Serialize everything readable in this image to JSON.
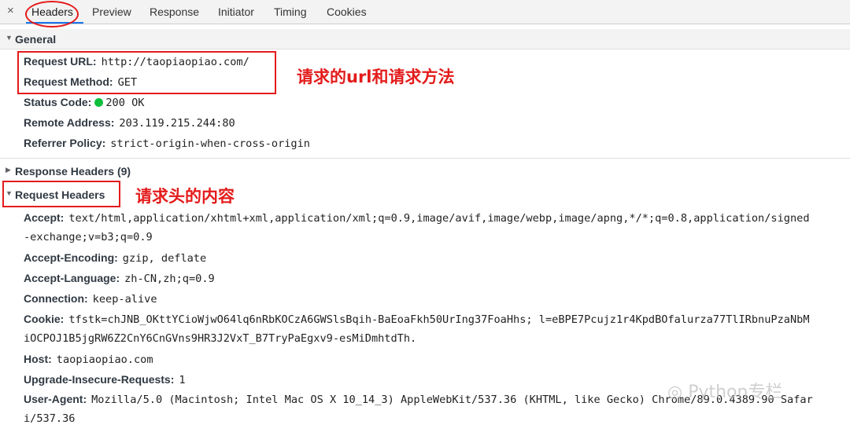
{
  "tabs": {
    "close_icon": "×",
    "items": [
      "Headers",
      "Preview",
      "Response",
      "Initiator",
      "Timing",
      "Cookies"
    ],
    "active": "Headers"
  },
  "general": {
    "title": "General",
    "rows": [
      {
        "key": "Request URL:",
        "value": "http://taopiaopiao.com/"
      },
      {
        "key": "Request Method:",
        "value": "GET"
      },
      {
        "key": "Status Code:",
        "value": "200 OK",
        "status_color": "#0dbf3c"
      },
      {
        "key": "Remote Address:",
        "value": "203.119.215.244:80"
      },
      {
        "key": "Referrer Policy:",
        "value": "strict-origin-when-cross-origin"
      }
    ]
  },
  "response_headers": {
    "title": "Response Headers (9)"
  },
  "request_headers": {
    "title": "Request Headers",
    "rows": [
      {
        "key": "Accept:",
        "value": "text/html,application/xhtml+xml,application/xml;q=0.9,image/avif,image/webp,image/apng,*/*;q=0.8,application/signed",
        "cont": "-exchange;v=b3;q=0.9"
      },
      {
        "key": "Accept-Encoding:",
        "value": "gzip, deflate"
      },
      {
        "key": "Accept-Language:",
        "value": "zh-CN,zh;q=0.9"
      },
      {
        "key": "Connection:",
        "value": "keep-alive"
      },
      {
        "key": "Cookie:",
        "value": "tfstk=chJNB_OKttYCioWjwO64lq6nRbKOCzA6GWSlsBqih-BaEoaFkh50UrIng37FoaHhs; l=eBPE7Pcujz1r4KpdBOfalurza77TlIRbnuPzaNbM",
        "cont": "iOCPOJ1B5jgRW6Z2CnY6CnGVns9HR3J2VxT_B7TryPaEgxv9-esMiDmhtdTh."
      },
      {
        "key": "Host:",
        "value": "taopiaopiao.com"
      },
      {
        "key": "Upgrade-Insecure-Requests:",
        "value": "1"
      },
      {
        "key": "User-Agent:",
        "value": "Mozilla/5.0 (Macintosh; Intel Mac OS X 10_14_3) AppleWebKit/537.36 (KHTML, like Gecko) Chrome/89.0.4389.90 Safar",
        "cont": "i/537.36"
      }
    ]
  },
  "annotations": {
    "url_method": "请求的url和请求方法",
    "request_headers": "请求头的内容"
  },
  "watermark": "Python专栏",
  "colors": {
    "annotation": "#e41b1b",
    "tab_underline": "#1a73e8"
  }
}
